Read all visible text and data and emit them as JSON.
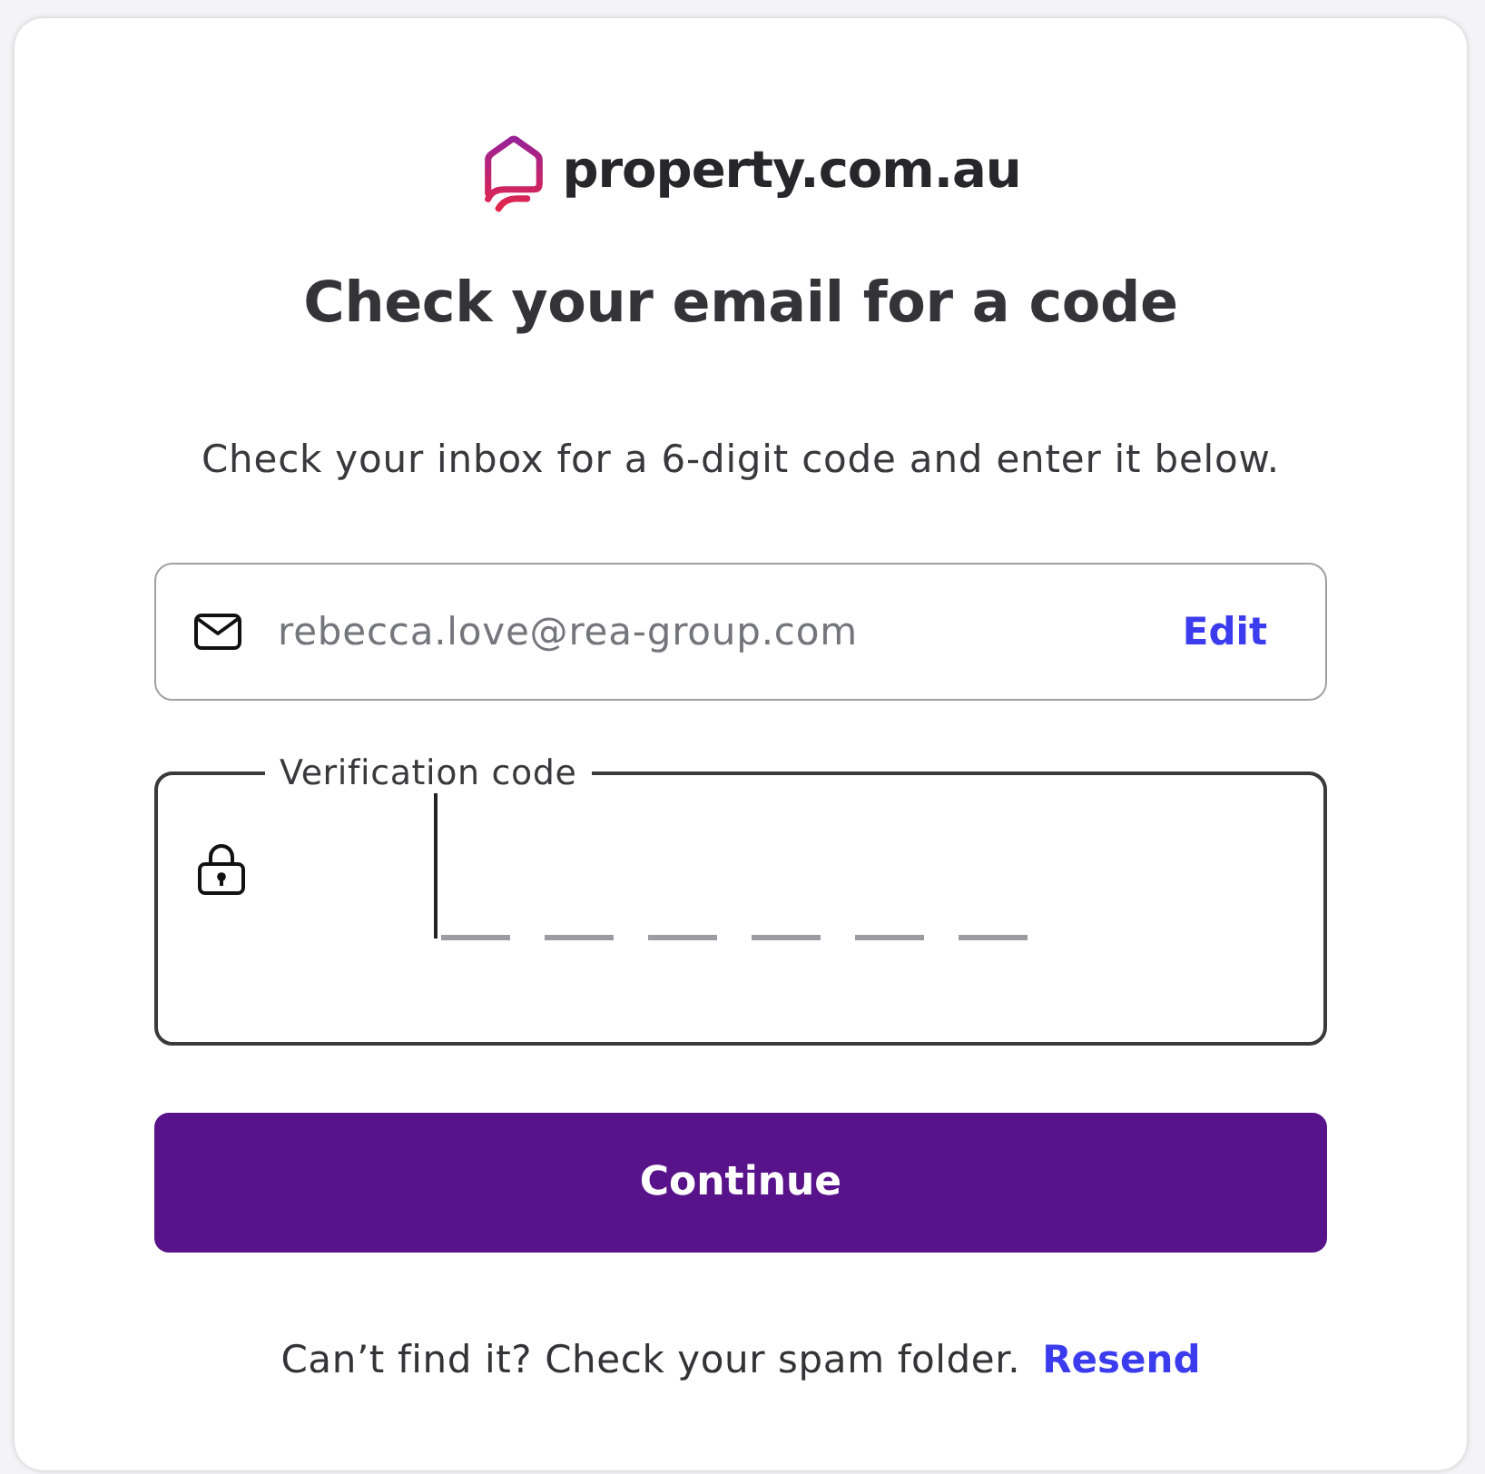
{
  "logo": {
    "text": "property.com.au"
  },
  "title": "Check your email for a code",
  "subtitle": "Check your inbox for a 6-digit code and enter it below.",
  "email_field": {
    "value": "rebecca.love@rea-group.com",
    "readonly": true,
    "action": "Edit"
  },
  "code_field": {
    "label": "Verification code",
    "focused": true
  },
  "continue_button": "Continue",
  "footer": {
    "text": "Can’t find it? Check your spam folder.",
    "link": "Resend"
  }
}
